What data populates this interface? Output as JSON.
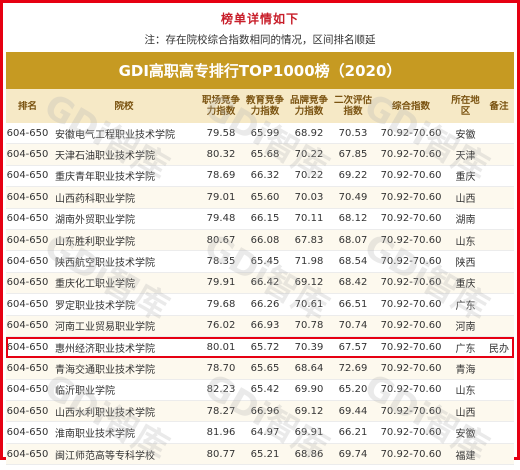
{
  "page": {
    "heading": "榜单详情如下",
    "note": "注：存在院校综合指数相同的情况，区间排名顺延",
    "table_title": "GDI高职高专排行TOP1000榜（2020）",
    "watermark": "GDi智库"
  },
  "columns": [
    {
      "label": "排名"
    },
    {
      "label": "院校"
    },
    {
      "label": "职场竞争力指数"
    },
    {
      "label": "教育竞争力指数"
    },
    {
      "label": "品牌竞争力指数"
    },
    {
      "label": "二次评估指数"
    },
    {
      "label": "综合指数"
    },
    {
      "label": "所在地区"
    },
    {
      "label": "备注"
    }
  ],
  "rows": [
    {
      "rank": "604-650",
      "school": "安徽电气工程职业技术学院",
      "career": "79.58",
      "education": "65.99",
      "brand": "68.92",
      "reeval": "70.53",
      "range": "70.92-70.60",
      "region": "安徽",
      "note": ""
    },
    {
      "rank": "604-650",
      "school": "天津石油职业技术学院",
      "career": "80.32",
      "education": "65.68",
      "brand": "70.22",
      "reeval": "67.85",
      "range": "70.92-70.60",
      "region": "天津",
      "note": ""
    },
    {
      "rank": "604-650",
      "school": "重庆青年职业技术学院",
      "career": "78.69",
      "education": "66.32",
      "brand": "70.22",
      "reeval": "69.22",
      "range": "70.92-70.60",
      "region": "重庆",
      "note": ""
    },
    {
      "rank": "604-650",
      "school": "山西药科职业学院",
      "career": "79.01",
      "education": "65.60",
      "brand": "70.03",
      "reeval": "70.49",
      "range": "70.92-70.60",
      "region": "山西",
      "note": ""
    },
    {
      "rank": "604-650",
      "school": "湖南外贸职业学院",
      "career": "79.48",
      "education": "66.15",
      "brand": "70.11",
      "reeval": "68.12",
      "range": "70.92-70.60",
      "region": "湖南",
      "note": ""
    },
    {
      "rank": "604-650",
      "school": "山东胜利职业学院",
      "career": "80.67",
      "education": "66.08",
      "brand": "67.83",
      "reeval": "68.07",
      "range": "70.92-70.60",
      "region": "山东",
      "note": ""
    },
    {
      "rank": "604-650",
      "school": "陕西航空职业技术学院",
      "career": "78.35",
      "education": "65.45",
      "brand": "71.98",
      "reeval": "68.54",
      "range": "70.92-70.60",
      "region": "陕西",
      "note": ""
    },
    {
      "rank": "604-650",
      "school": "重庆化工职业学院",
      "career": "79.91",
      "education": "66.42",
      "brand": "69.12",
      "reeval": "68.42",
      "range": "70.92-70.60",
      "region": "重庆",
      "note": ""
    },
    {
      "rank": "604-650",
      "school": "罗定职业技术学院",
      "career": "79.68",
      "education": "66.26",
      "brand": "70.61",
      "reeval": "66.51",
      "range": "70.92-70.60",
      "region": "广东",
      "note": ""
    },
    {
      "rank": "604-650",
      "school": "河南工业贸易职业学院",
      "career": "76.02",
      "education": "66.93",
      "brand": "70.78",
      "reeval": "70.74",
      "range": "70.92-70.60",
      "region": "河南",
      "note": ""
    },
    {
      "rank": "604-650",
      "school": "惠州经济职业技术学院",
      "career": "80.01",
      "education": "65.72",
      "brand": "70.39",
      "reeval": "67.57",
      "range": "70.92-70.60",
      "region": "广东",
      "note": "民办",
      "highlight": true
    },
    {
      "rank": "604-650",
      "school": "青海交通职业技术学院",
      "career": "78.70",
      "education": "65.65",
      "brand": "68.64",
      "reeval": "72.69",
      "range": "70.92-70.60",
      "region": "青海",
      "note": ""
    },
    {
      "rank": "604-650",
      "school": "临沂职业学院",
      "career": "82.23",
      "education": "65.42",
      "brand": "69.90",
      "reeval": "65.20",
      "range": "70.92-70.60",
      "region": "山东",
      "note": ""
    },
    {
      "rank": "604-650",
      "school": "山西水利职业技术学院",
      "career": "78.27",
      "education": "66.96",
      "brand": "69.12",
      "reeval": "69.44",
      "range": "70.92-70.60",
      "region": "山西",
      "note": ""
    },
    {
      "rank": "604-650",
      "school": "淮南职业技术学院",
      "career": "81.96",
      "education": "64.97",
      "brand": "69.91",
      "reeval": "66.21",
      "range": "70.92-70.60",
      "region": "安徽",
      "note": ""
    },
    {
      "rank": "604-650",
      "school": "闽江师范高等专科学校",
      "career": "80.77",
      "education": "65.21",
      "brand": "68.86",
      "reeval": "69.74",
      "range": "70.92-70.60",
      "region": "福建",
      "note": ""
    }
  ]
}
